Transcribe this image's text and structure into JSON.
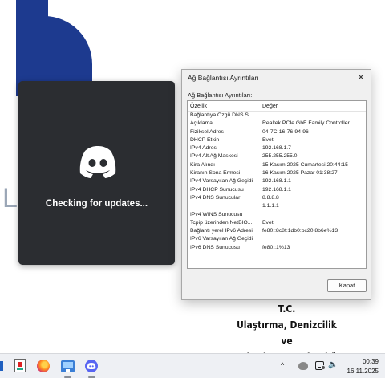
{
  "wallpaper": {
    "letter": "L",
    "caption_lines": [
      "T.C.",
      "Ulaştırma, Denizcilik ve",
      "Haberleşme Bakanlığı"
    ],
    "brand_color": "#1d3a8f"
  },
  "discord_updater": {
    "status_text": "Checking for updates...",
    "logo_icon": "discord-logo-icon"
  },
  "dialog": {
    "title": "Ağ Bağlantısı Ayrıntıları",
    "close_glyph": "✕",
    "caption": "Ağ Bağlantısı Ayrıntıları:",
    "columns": [
      "Özellik",
      "Değer"
    ],
    "rows": [
      [
        "Bağlantıya Özgü DNS S...",
        ""
      ],
      [
        "Açıklama",
        "Realtek PCIe GbE Family Controller"
      ],
      [
        "Fiziksel Adres",
        "04-7C-16-76-94-96"
      ],
      [
        "DHCP Etkin",
        "Evet"
      ],
      [
        "IPv4 Adresi",
        "192.168.1.7"
      ],
      [
        "IPv4 Alt Ağ Maskesi",
        "255.255.255.0"
      ],
      [
        "Kira Alındı",
        "15 Kasım 2025 Cumartesi 20:44:15"
      ],
      [
        "Kiranın Sona Ermesi",
        "16 Kasım 2025 Pazar 01:38:27"
      ],
      [
        "IPv4 Varsayılan Ağ Geçidi",
        "192.168.1.1"
      ],
      [
        "IPv4 DHCP Sunucusu",
        "192.168.1.1"
      ],
      [
        "IPv4 DNS Sunucuları",
        "8.8.8.8"
      ],
      [
        "",
        "1.1.1.1"
      ],
      [
        "IPv4 WINS Sunucusu",
        ""
      ],
      [
        "Tcpip üzerinden NetBIO...",
        "Evet"
      ],
      [
        "Bağlantı yerel IPv6 Adresi",
        "fe80::8c8f:1db0:bc20:8b6e%13"
      ],
      [
        "IPv6 Varsayılan Ağ Geçidi",
        ""
      ],
      [
        "IPv6 DNS Sunucusu",
        "fe80::1%13"
      ]
    ],
    "close_button": "Kapat"
  },
  "taskbar": {
    "apps": [
      {
        "name": "app-icon",
        "active": false
      },
      {
        "name": "firefox-icon",
        "active": false
      },
      {
        "name": "remote-desktop-icon",
        "active": true
      },
      {
        "name": "discord-icon",
        "active": true
      }
    ],
    "tray": {
      "chevron": "^",
      "volume_glyph": "🔈"
    },
    "clock": {
      "time": "00:39",
      "date": "16.11.2025"
    }
  }
}
